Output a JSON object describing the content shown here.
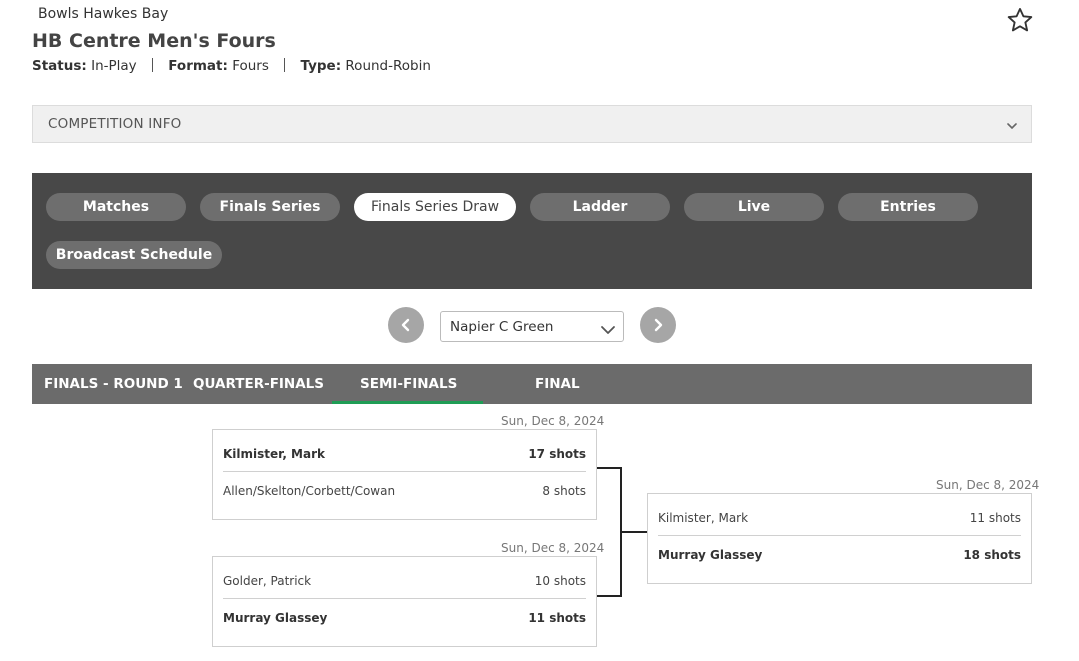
{
  "header": {
    "organisation": "Bowls Hawkes Bay",
    "title": "HB Centre Men's Fours",
    "status_label": "Status:",
    "status_value": "In-Play",
    "format_label": "Format:",
    "format_value": "Fours",
    "type_label": "Type:",
    "type_value": "Round-Robin",
    "favourite_icon": "star-outline-icon"
  },
  "competition_info": {
    "label": "COMPETITION INFO",
    "icon": "chevron-down-icon"
  },
  "nav": {
    "tabs": [
      {
        "label": "Matches"
      },
      {
        "label": "Finals Series"
      },
      {
        "label": "Finals Series Draw"
      },
      {
        "label": "Ladder"
      },
      {
        "label": "Live"
      },
      {
        "label": "Entries"
      },
      {
        "label": "Broadcast Schedule"
      }
    ],
    "active_index": 2
  },
  "venue": {
    "selected": "Napier C Green",
    "prev_icon": "chevron-left-icon",
    "next_icon": "chevron-right-icon"
  },
  "rounds": {
    "tabs": [
      {
        "label": "FINALS - ROUND 1"
      },
      {
        "label": "QUARTER-FINALS"
      },
      {
        "label": "SEMI-FINALS"
      },
      {
        "label": "FINAL"
      }
    ],
    "active_index": 2,
    "accent_color": "#1f9d55"
  },
  "matches": {
    "semi_1": {
      "date": "Sun, Dec 8, 2024",
      "team_1": {
        "name": "Kilmister, Mark",
        "score": "17 shots"
      },
      "team_2": {
        "name": "Allen/Skelton/Corbett/Cowan",
        "score": "8 shots"
      }
    },
    "semi_2": {
      "date": "Sun, Dec 8, 2024",
      "team_1": {
        "name": "Golder, Patrick",
        "score": "10 shots"
      },
      "team_2": {
        "name": "Murray Glassey",
        "score": "11 shots"
      }
    },
    "final": {
      "date": "Sun, Dec 8, 2024",
      "team_1": {
        "name": "Kilmister, Mark",
        "score": "11 shots"
      },
      "team_2": {
        "name": "Murray Glassey",
        "score": "18 shots"
      }
    }
  }
}
